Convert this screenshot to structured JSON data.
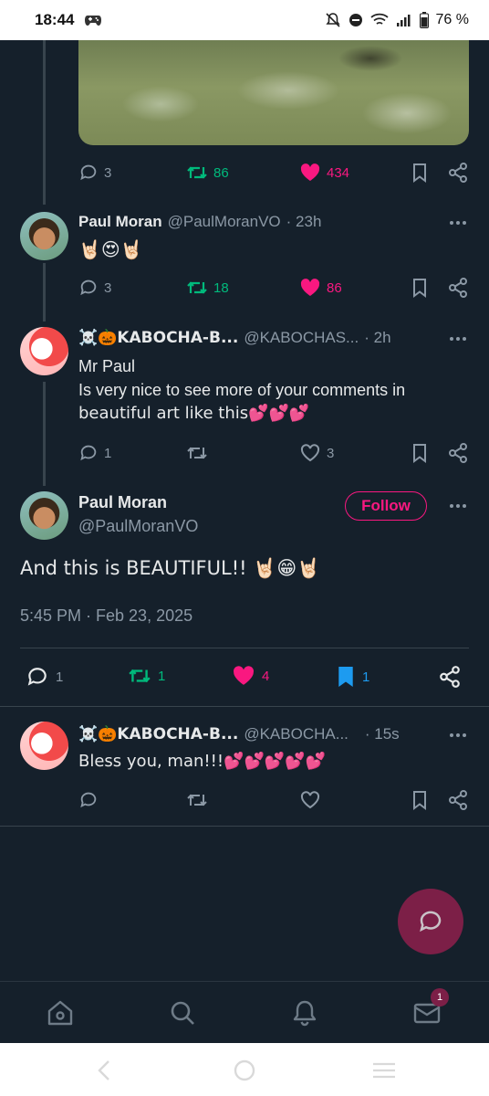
{
  "status_bar": {
    "time": "18:44",
    "battery": "76 %"
  },
  "posts": [
    {
      "stats": {
        "replies": "3",
        "reposts": "86",
        "likes": "434"
      }
    },
    {
      "name": "Paul Moran",
      "handle": "@PaulMoranVO",
      "time": "· 23h",
      "text": "🤘🏻😍🤘🏻",
      "stats": {
        "replies": "3",
        "reposts": "18",
        "likes": "86"
      }
    },
    {
      "name": "☠️🎃KABOCHA-B...",
      "handle": "@KABOCHAS...",
      "time": "· 2h",
      "text_lines": [
        "Mr Paul",
        "Is very nice to see more of your comments in",
        "beautiful art like this💕💕💕"
      ],
      "stats": {
        "replies": "1",
        "likes": "3"
      }
    }
  ],
  "main_post": {
    "name": "Paul Moran",
    "handle": "@PaulMoranVO",
    "follow_label": "Follow",
    "text": "And this is BEAUTIFUL!! 🤘🏻😁🤘🏻",
    "date": "5:45 PM · Feb 23, 2025",
    "stats": {
      "replies": "1",
      "reposts": "1",
      "likes": "4",
      "bookmarks": "1"
    }
  },
  "reply_post": {
    "name": "☠️🎃KABOCHA-B...",
    "handle": "@KABOCHA...",
    "time": "· 15s",
    "text": "Bless you, man!!!💕💕💕💕💕"
  },
  "bottom_nav": {
    "messages_badge": "1"
  },
  "colors": {
    "background": "#15202b",
    "accent_pink": "#f91880",
    "repost_green": "#00ba7c",
    "bookmark_blue": "#1d9bf0",
    "muted": "#8b98a5"
  },
  "icons": [
    "reply-icon",
    "repost-icon",
    "like-icon",
    "bookmark-icon",
    "share-icon",
    "more-icon",
    "compose-icon",
    "home-icon",
    "search-icon",
    "notifications-icon",
    "messages-icon"
  ]
}
